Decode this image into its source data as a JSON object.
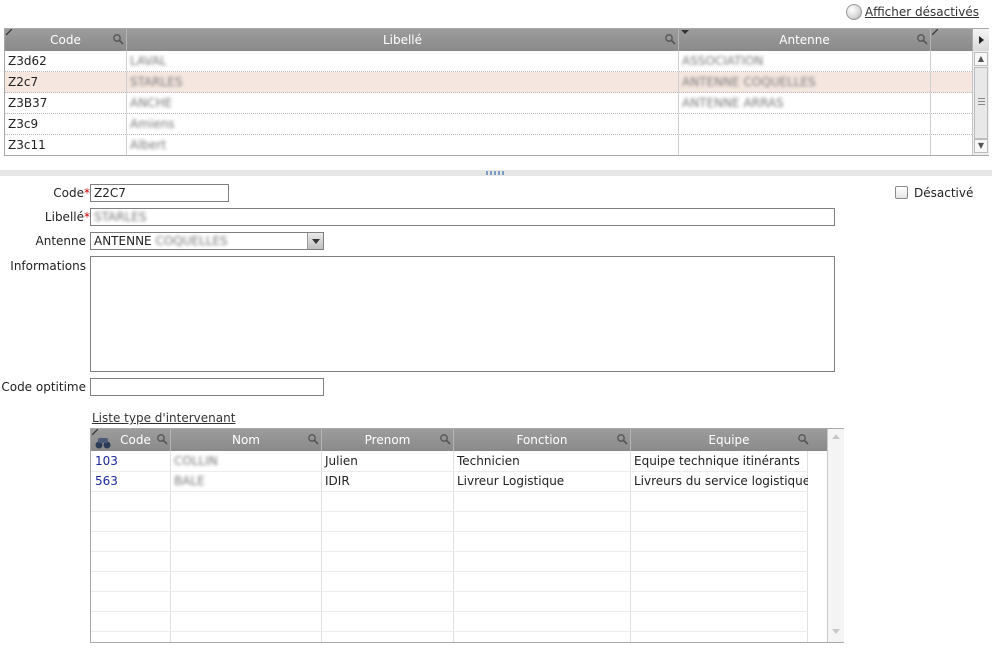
{
  "header": {
    "show_disabled_label": "Afficher désactivés"
  },
  "top_grid": {
    "columns": [
      "Code",
      "Libellé",
      "Antenne"
    ],
    "rows": [
      {
        "code": "Z3d62",
        "libelle": "LAVAL",
        "antenne": "ASSOCIATION"
      },
      {
        "code": "Z2c7",
        "libelle": "STARLES",
        "antenne": "ANTENNE COQUELLES"
      },
      {
        "code": "Z3B37",
        "libelle": "ANCHE",
        "antenne": "ANTENNE ARRAS"
      },
      {
        "code": "Z3c9",
        "libelle": "Amiens",
        "antenne": ""
      },
      {
        "code": "Z3c11",
        "libelle": "Albert",
        "antenne": ""
      }
    ],
    "selected_row": 1
  },
  "form": {
    "code_label": "Code",
    "code_value": "Z2C7",
    "libelle_label": "Libellé",
    "libelle_value": "STARLES",
    "antenne_label": "Antenne",
    "antenne_value_prefix": "ANTENNE",
    "antenne_value_blurred": "COQUELLES",
    "informations_label": "Informations",
    "code_optitime_label": "Code optitime",
    "desactive_label": "Désactivé",
    "required_marker": "*"
  },
  "sub_grid": {
    "title": "Liste type d'intervenant",
    "columns": [
      "Code",
      "Nom",
      "Prenom",
      "Fonction",
      "Equipe"
    ],
    "rows": [
      {
        "code": "103",
        "nom": "COLLIN",
        "prenom": "Julien",
        "fonction": "Technicien",
        "equipe": "Equipe technique itinérants"
      },
      {
        "code": "563",
        "nom": "BALE",
        "prenom": "IDIR",
        "fonction": "Livreur Logistique",
        "equipe": "Livreurs du service logistique"
      }
    ]
  },
  "colors": {
    "header_bg": "#8f8f8f",
    "selected_row_bg": "#f5e6e0",
    "code_link_color": "#1a2a9a",
    "required_color": "#d00000"
  }
}
